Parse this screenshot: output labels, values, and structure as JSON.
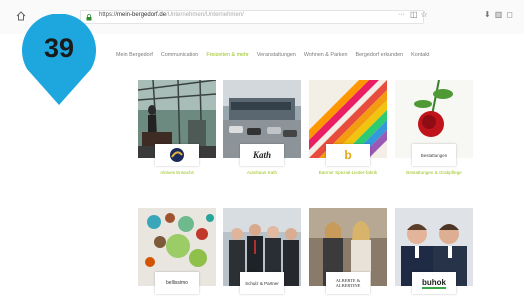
{
  "browser": {
    "url_prefix": "https://",
    "url_host": "mein-bergedorf.de",
    "url_path": "/Unternehmen/Unternehmen/"
  },
  "marker": {
    "number": "39"
  },
  "nav": {
    "items": [
      {
        "label": "Mein Bergedorf",
        "active": false
      },
      {
        "label": "Communication",
        "active": false
      },
      {
        "label": "Freizeiten & mehr",
        "active": true
      },
      {
        "label": "Veranstaltungen",
        "active": false
      },
      {
        "label": "Wohnen & Parken",
        "active": false
      },
      {
        "label": "Bergedorf erkunden",
        "active": false
      },
      {
        "label": "Kontakt",
        "active": false
      }
    ]
  },
  "tiles": [
    {
      "caption": "Aktives Erwachs",
      "logo_text": ""
    },
    {
      "caption": "Autohaus Kath",
      "logo_text": "Kath"
    },
    {
      "caption": "Barmer Spezial-Lieder-fabrik",
      "logo_text": "b"
    },
    {
      "caption": "Bestattungen & Grabpflege",
      "logo_text": "Bestattungen"
    },
    {
      "caption": "",
      "logo_text": "bellissimo"
    },
    {
      "caption": "",
      "logo_text": "Schulz & Partner"
    },
    {
      "caption": "",
      "logo_text": "ALBERTE & ALBERTINE"
    },
    {
      "caption": "",
      "logo_text": "buhok"
    }
  ],
  "colors": {
    "accent": "#9bc21b",
    "pin": "#1ea7df"
  }
}
